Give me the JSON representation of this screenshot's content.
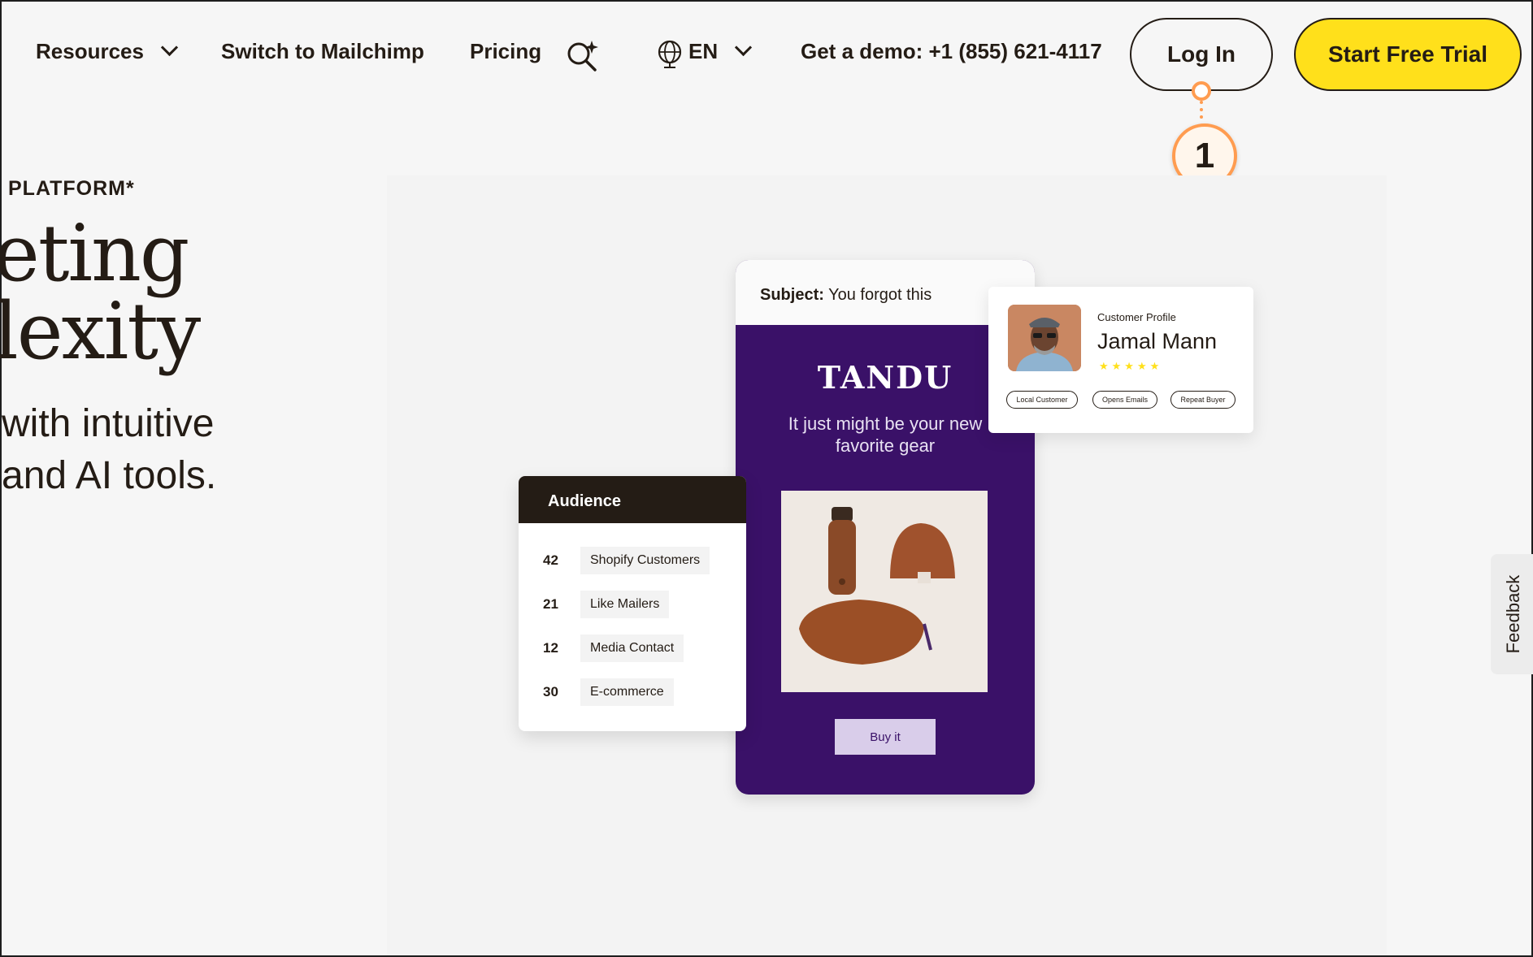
{
  "nav": {
    "resources": "Resources",
    "switch": "Switch to Mailchimp",
    "pricing": "Pricing",
    "language": "EN",
    "demo": "Get a demo: +1 (855) 621-4117",
    "login": "Log In",
    "trial": "Start Free Trial"
  },
  "annotation": {
    "number": "1"
  },
  "hero": {
    "eyebrow": "PLATFORM*",
    "headline_line1": "eting",
    "headline_line2": "lexity",
    "sub_line1": "with intuitive",
    "sub_line2": "and AI tools."
  },
  "email": {
    "subject_label": "Subject:",
    "subject_text": "You forgot this",
    "brand": "TANDU",
    "tagline": "It just might be your new favorite gear",
    "buy": "Buy it"
  },
  "audience": {
    "title": "Audience",
    "rows": [
      {
        "count": "42",
        "label": "Shopify Customers"
      },
      {
        "count": "21",
        "label": "Like Mailers"
      },
      {
        "count": "12",
        "label": "Media Contact"
      },
      {
        "count": "30",
        "label": "E-commerce"
      }
    ]
  },
  "profile": {
    "label": "Customer Profile",
    "name": "Jamal Mann",
    "stars": "★★★★★",
    "tags": [
      "Local Customer",
      "Opens Emails",
      "Repeat Buyer"
    ]
  },
  "feedback": "Feedback",
  "colors": {
    "brand_yellow": "#ffe01b",
    "email_purple": "#3a1168",
    "annotation_orange": "#ff9c50"
  }
}
